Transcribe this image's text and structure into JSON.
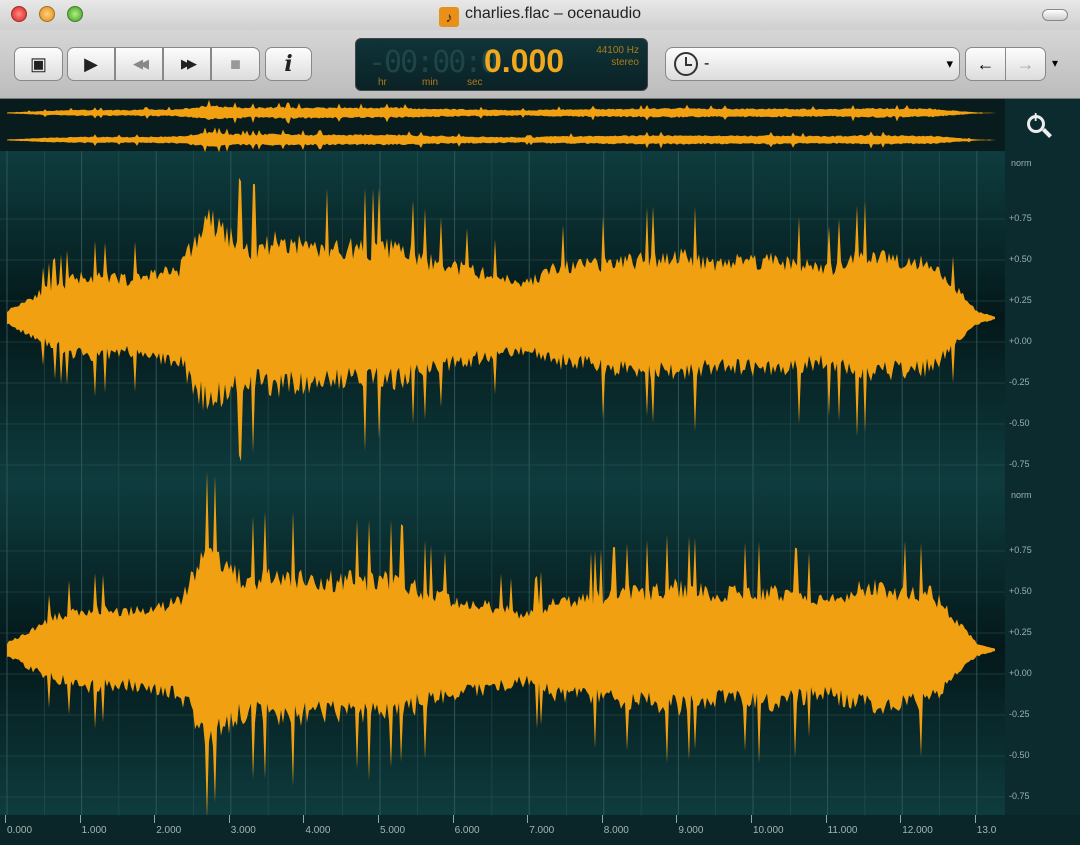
{
  "window": {
    "title": "charlies.flac – ocenaudio",
    "app_icon": "music-note-icon"
  },
  "toolbar": {
    "buttons": [
      {
        "name": "play-selection",
        "icon": "play-in-box-icon"
      },
      {
        "name": "play",
        "icon": "play-icon"
      },
      {
        "name": "rewind",
        "icon": "rewind-icon"
      },
      {
        "name": "fast-forward",
        "icon": "fast-forward-icon"
      },
      {
        "name": "stop",
        "icon": "stop-icon"
      },
      {
        "name": "info",
        "icon": "info-icon"
      }
    ],
    "icons": {
      "play_sel": "▣",
      "play": "▶",
      "rew": "◀◀",
      "ff": "▶▶",
      "stop": "■",
      "info": "i"
    }
  },
  "display": {
    "dim_digits": "-00:00:0",
    "time": "0.000",
    "hr": "hr",
    "min": "min",
    "sec": "sec",
    "rate": "44100 Hz",
    "channels": "stereo"
  },
  "history": {
    "value": "-",
    "back": "←",
    "forward": "→",
    "dropdown": "▾"
  },
  "colors": {
    "waveform": "#f0a010",
    "background": "#0a2a2c",
    "accent": "#f2a81e"
  },
  "ruler": {
    "label": "norm",
    "ticks": [
      "+0.75",
      "+0.50",
      "+0.25",
      "+0.00",
      "-0.25",
      "-0.50",
      "-0.75"
    ]
  },
  "time_axis": {
    "labels": [
      "0.000",
      "1.000",
      "2.000",
      "3.000",
      "4.000",
      "5.000",
      "6.000",
      "7.000",
      "8.000",
      "9.000",
      "10.000",
      "11.000",
      "12.000",
      "13.0"
    ]
  }
}
